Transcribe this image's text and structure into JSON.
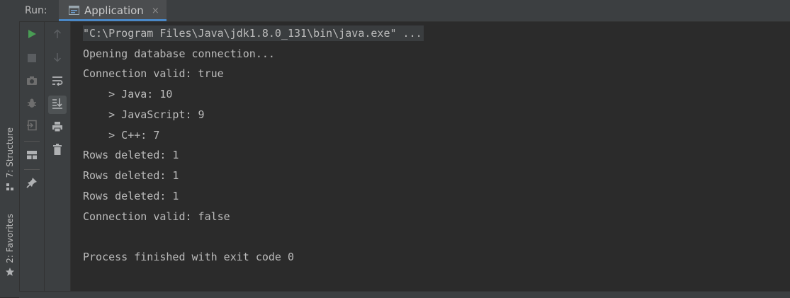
{
  "header": {
    "run_label": "Run:",
    "tab_label": "Application",
    "tab_close": "×"
  },
  "side_tabs": {
    "structure": "7: Structure",
    "favorites": "2: Favorites"
  },
  "toolbar": {
    "run": "run-icon",
    "stop": "stop-icon",
    "screenshot": "camera-icon",
    "debug": "bug-icon",
    "exit": "exit-icon",
    "layout": "layout-icon",
    "pin": "pin-icon",
    "up": "arrow-up-icon",
    "down": "arrow-down-icon",
    "wrap": "soft-wrap-icon",
    "scroll_end": "scroll-to-end-icon",
    "print": "print-icon",
    "trash": "trash-icon"
  },
  "console": {
    "lines": [
      "\"C:\\Program Files\\Java\\jdk1.8.0_131\\bin\\java.exe\" ...",
      "Opening database connection...",
      "Connection valid: true",
      "    > Java: 10",
      "    > JavaScript: 9",
      "    > C++: 7",
      "Rows deleted: 1",
      "Rows deleted: 1",
      "Rows deleted: 1",
      "Connection valid: false",
      "",
      "Process finished with exit code 0"
    ]
  },
  "colors": {
    "background": "#2b2b2b",
    "panel": "#3c3f41",
    "run_green": "#499c54",
    "accent": "#4a88c7",
    "text": "#bbbbbb"
  }
}
